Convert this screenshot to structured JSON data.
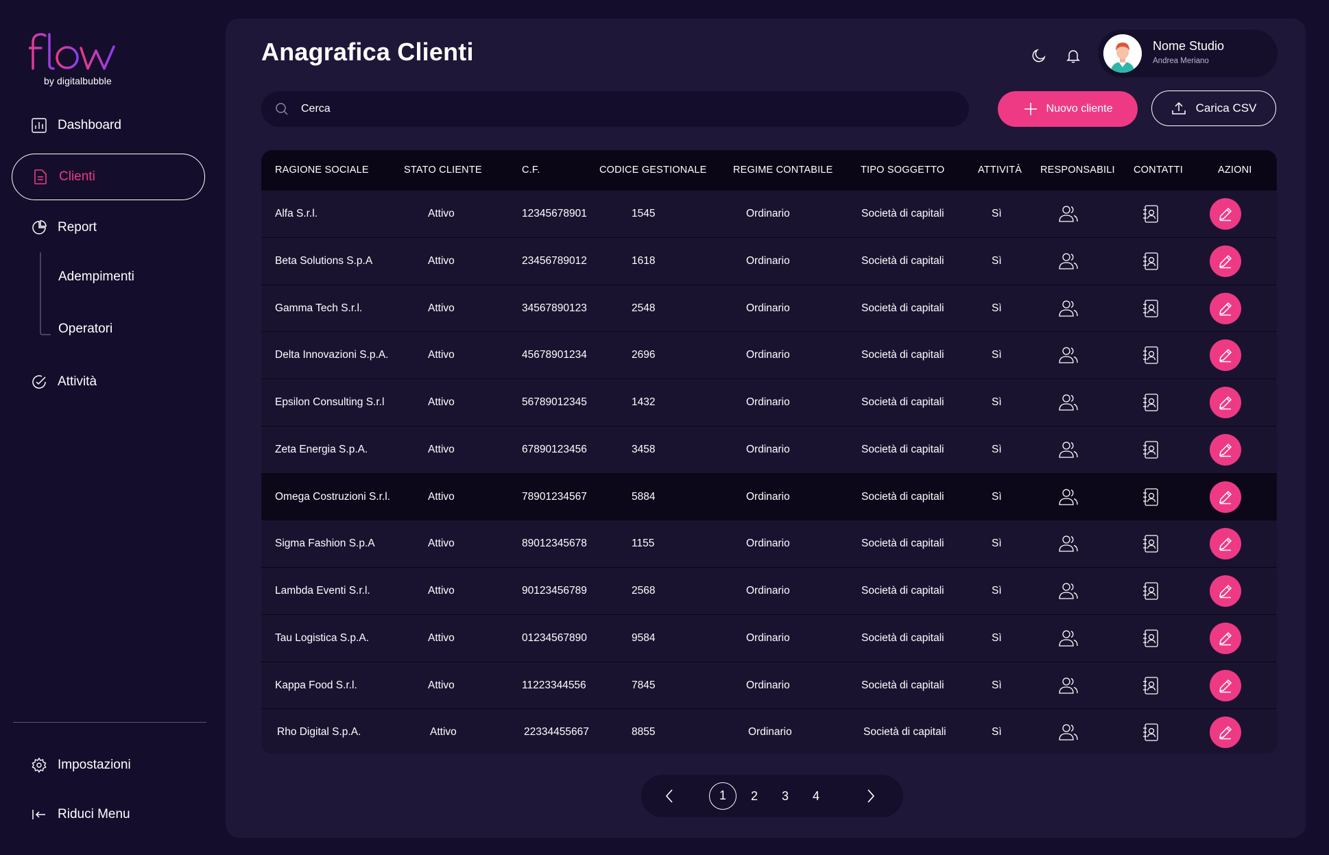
{
  "colors": {
    "accent": "#ee3a84",
    "background": "#140e2c",
    "panel": "#1f1738",
    "table": "#0b0615",
    "row": "#1a1330"
  },
  "brand": {
    "name": "flow",
    "sub": "by digitalbubble"
  },
  "sidebar": {
    "items": [
      {
        "label": "Dashboard",
        "icon": "bar-chart-icon"
      },
      {
        "label": "Clienti",
        "icon": "document-icon",
        "active": true
      },
      {
        "label": "Report",
        "icon": "pie-chart-icon"
      },
      {
        "label": "Adempimenti"
      },
      {
        "label": "Operatori"
      },
      {
        "label": "Attività",
        "icon": "check-circle-icon"
      }
    ],
    "settings_label": "Impostazioni",
    "collapse_label": "Riduci Menu"
  },
  "header": {
    "title": "Anagrafica Clienti",
    "icons": [
      "moon-icon",
      "bell-icon"
    ],
    "profile": {
      "name": "Nome Studio",
      "sub": "Andrea Meriano"
    }
  },
  "toolbar": {
    "search_placeholder": "Cerca",
    "new_client_label": "Nuovo cliente",
    "upload_csv_label": "Carica CSV"
  },
  "table": {
    "columns": [
      "RAGIONE SOCIALE",
      "STATO CLIENTE",
      "C.F.",
      "CODICE GESTIONALE",
      "REGIME CONTABILE",
      "TIPO SOGGETTO",
      "ATTIVITÀ",
      "RESPONSABILI",
      "CONTATTI",
      "AZIONI"
    ],
    "rows": [
      {
        "ragione": "Alfa S.r.l.",
        "stato": "Attivo",
        "cf": "12345678901",
        "codice": "1545",
        "regime": "Ordinario",
        "tipo": "Società di capitali",
        "attivita": "Sì"
      },
      {
        "ragione": "Beta Solutions S.p.A",
        "stato": "Attivo",
        "cf": "23456789012",
        "codice": "1618",
        "regime": "Ordinario",
        "tipo": "Società di capitali",
        "attivita": "Sì"
      },
      {
        "ragione": "Gamma Tech S.r.l.",
        "stato": "Attivo",
        "cf": "34567890123",
        "codice": "2548",
        "regime": "Ordinario",
        "tipo": "Società di capitali",
        "attivita": "Sì"
      },
      {
        "ragione": "Delta Innovazioni S.p.A.",
        "stato": "Attivo",
        "cf": "45678901234",
        "codice": "2696",
        "regime": "Ordinario",
        "tipo": "Società di capitali",
        "attivita": "Sì"
      },
      {
        "ragione": "Epsilon Consulting S.r.l",
        "stato": "Attivo",
        "cf": "56789012345",
        "codice": "1432",
        "regime": "Ordinario",
        "tipo": "Società di capitali",
        "attivita": "Sì"
      },
      {
        "ragione": "Zeta Energia S.p.A.",
        "stato": "Attivo",
        "cf": "67890123456",
        "codice": "3458",
        "regime": "Ordinario",
        "tipo": "Società di capitali",
        "attivita": "Sì"
      },
      {
        "ragione": "Omega Costruzioni S.r.l.",
        "stato": "Attivo",
        "cf": "78901234567",
        "codice": "5884",
        "regime": "Ordinario",
        "tipo": "Società di capitali",
        "attivita": "Sì",
        "highlighted": true
      },
      {
        "ragione": "Sigma Fashion S.p.A",
        "stato": "Attivo",
        "cf": "89012345678",
        "codice": "1155",
        "regime": "Ordinario",
        "tipo": "Società di capitali",
        "attivita": "Sì"
      },
      {
        "ragione": "Lambda Eventi S.r.l.",
        "stato": "Attivo",
        "cf": "90123456789",
        "codice": "2568",
        "regime": "Ordinario",
        "tipo": "Società di capitali",
        "attivita": "Sì"
      },
      {
        "ragione": "Tau Logistica S.p.A.",
        "stato": "Attivo",
        "cf": "01234567890",
        "codice": "9584",
        "regime": "Ordinario",
        "tipo": "Società di capitali",
        "attivita": "Sì"
      },
      {
        "ragione": "Kappa Food S.r.l.",
        "stato": "Attivo",
        "cf": "11223344556",
        "codice": "7845",
        "regime": "Ordinario",
        "tipo": "Società di capitali",
        "attivita": "Sì"
      },
      {
        "ragione": "Rho Digital S.p.A.",
        "stato": "Attivo",
        "cf": "22334455667",
        "codice": "8855",
        "regime": "Ordinario",
        "tipo": "Società di capitali",
        "attivita": "Sì"
      }
    ],
    "row_icons": {
      "responsabili": "users-icon",
      "contatti": "contact-book-icon",
      "azioni": "edit-pencil-icon"
    }
  },
  "pagination": {
    "pages": [
      "1",
      "2",
      "3",
      "4"
    ],
    "current": "1"
  }
}
